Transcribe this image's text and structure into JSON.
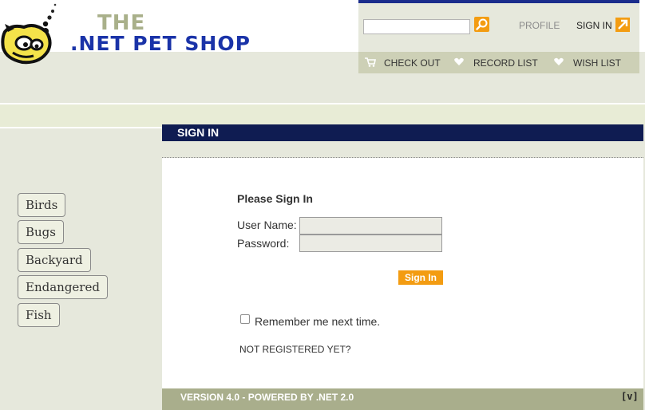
{
  "logo": {
    "line1": "THE",
    "line2": ".NET PET SHOP"
  },
  "header": {
    "search": {
      "value": "",
      "placeholder": ""
    },
    "profile_label": "PROFILE",
    "signin_label": "SIGN IN",
    "checkout_label": "CHECK OUT",
    "record_list_label": "RECORD LIST",
    "wish_list_label": "WISH LIST"
  },
  "page": {
    "title": "SIGN IN"
  },
  "sidebar": {
    "categories": [
      "Birds",
      "Bugs",
      "Backyard",
      "Endangered",
      "Fish"
    ]
  },
  "login": {
    "heading": "Please Sign In",
    "username_label": "User Name:",
    "username_value": "",
    "password_label": "Password:",
    "password_value": "",
    "submit_label": "Sign In",
    "remember_label": "Remember me next time.",
    "remember_checked": false,
    "not_registered": "NOT REGISTERED YET?"
  },
  "footer": {
    "version_text": "VERSION 4.0 - POWERED BY .NET 2.0",
    "badge": "[v]"
  },
  "colors": {
    "accent": "#f39c12",
    "title_bar": "#0f1c52",
    "nav_top": "#1b2d8c",
    "logo_blue": "#1a33a8",
    "logo_olive": "#a9b08a",
    "footer": "#a9ae8c"
  },
  "icons": {
    "search": "magnifier-icon",
    "signin": "arrow-up-right-icon",
    "checkout": "cart-icon",
    "record_list": "heart-icon",
    "wish_list": "heart-icon"
  }
}
